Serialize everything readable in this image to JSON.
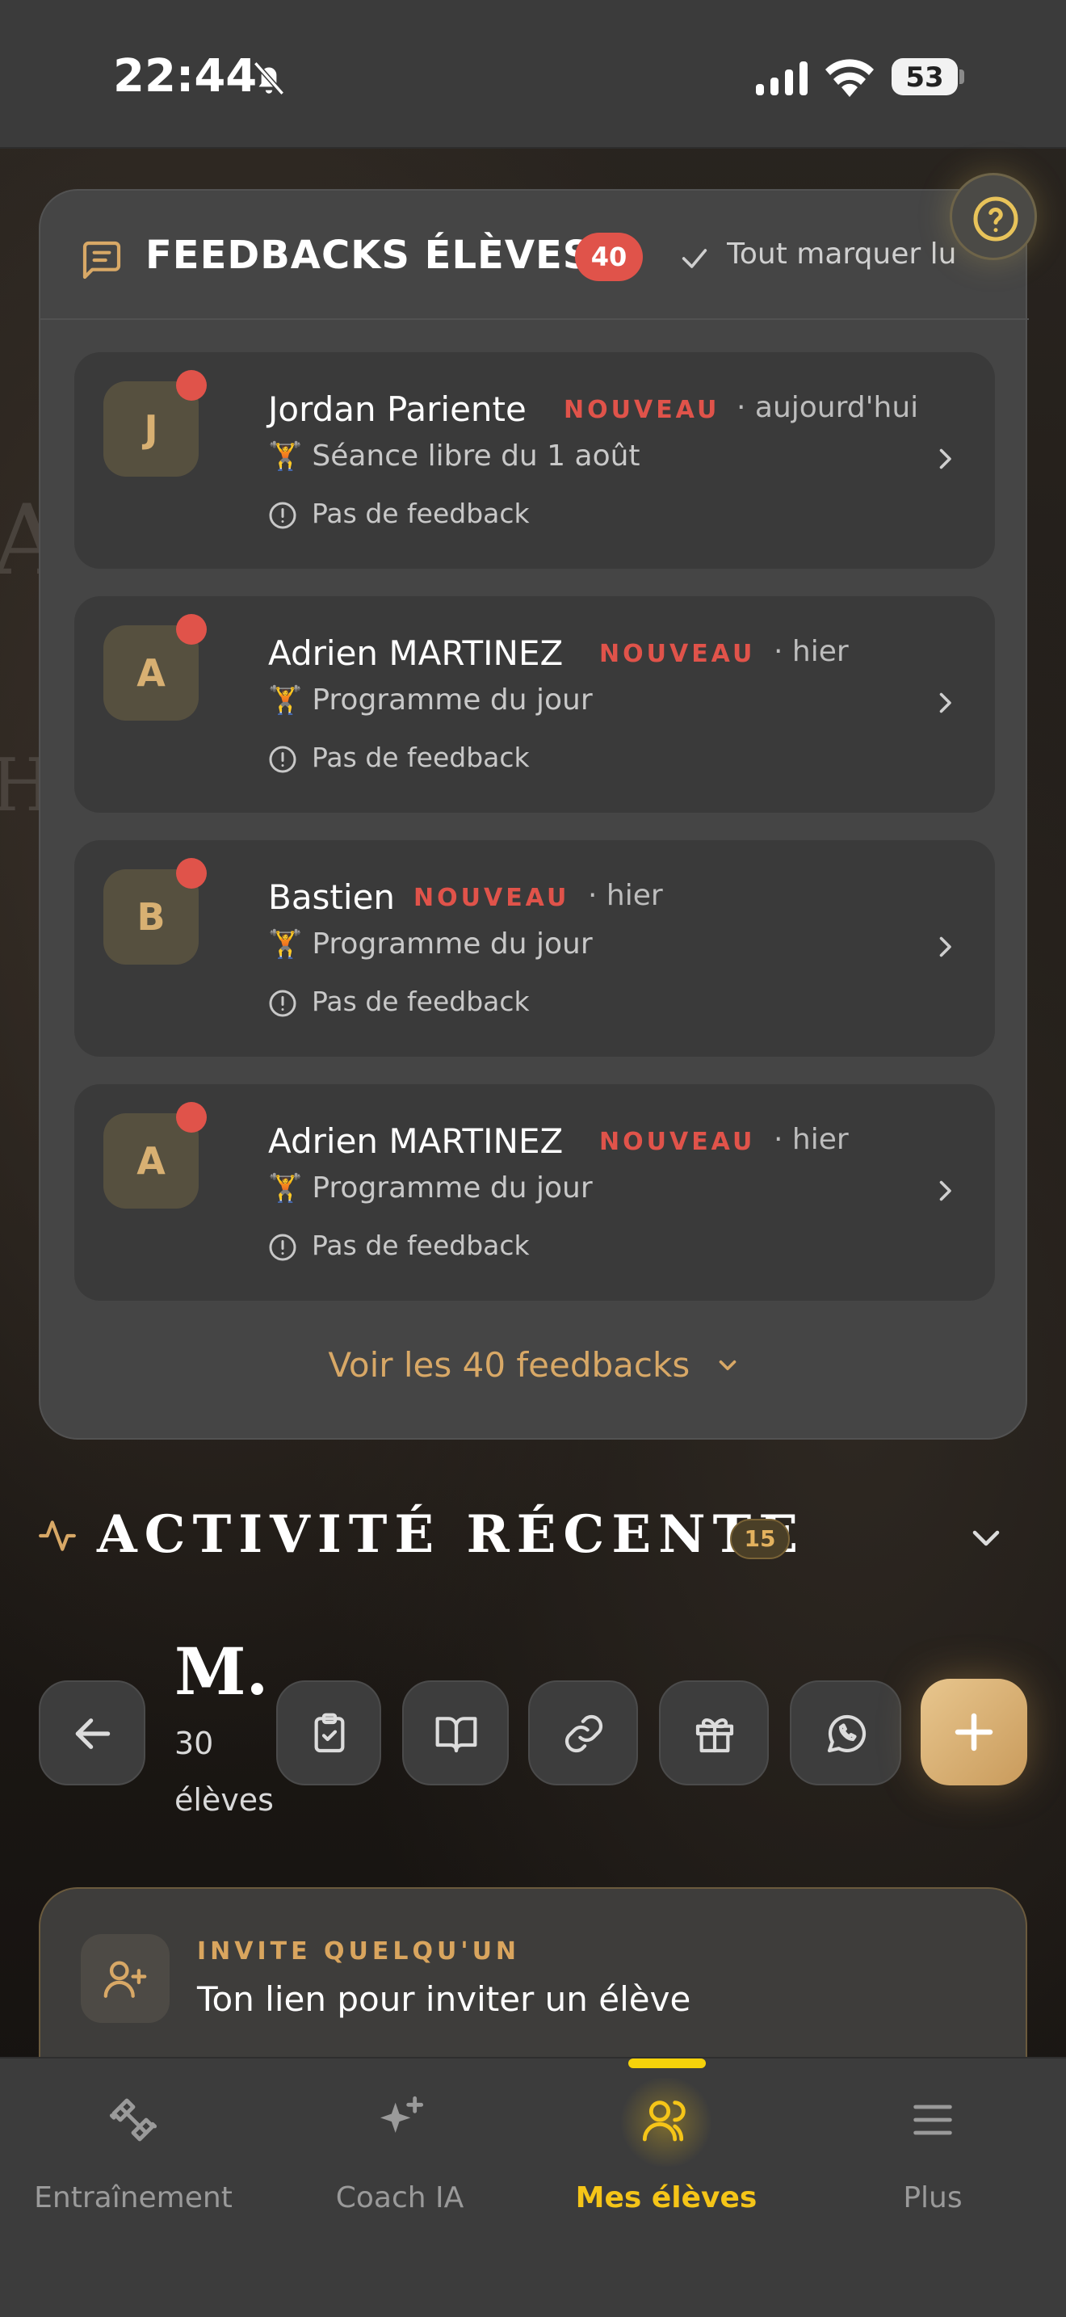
{
  "status_bar": {
    "time": "22:44",
    "battery": "53"
  },
  "feedbacks": {
    "title": "FEEDBACKS ÉLÈVES",
    "badge": "40",
    "mark_all": "Tout marquer lu",
    "items": [
      {
        "initial": "J",
        "name": "Jordan Pariente",
        "tag": "NOUVEAU",
        "when": "· aujourd'hui",
        "emoji": "🏋️",
        "session": "Séance libre du 1 août",
        "info": "Pas de feedback"
      },
      {
        "initial": "A",
        "name": "Adrien MARTINEZ",
        "tag": "NOUVEAU",
        "when": "· hier",
        "emoji": "🏋️",
        "session": "Programme du jour",
        "info": "Pas de feedback"
      },
      {
        "initial": "B",
        "name": "Bastien",
        "tag": "NOUVEAU",
        "when": "· hier",
        "emoji": "🏋️",
        "session": "Programme du jour",
        "info": "Pas de feedback"
      },
      {
        "initial": "A",
        "name": "Adrien MARTINEZ",
        "tag": "NOUVEAU",
        "when": "· hier",
        "emoji": "🏋️",
        "session": "Programme du jour",
        "info": "Pas de feedback"
      }
    ],
    "see_all": "Voir les 40 feedbacks"
  },
  "activity": {
    "title": "ACTIVITÉ RÉCENTE",
    "badge": "15"
  },
  "toolbar": {
    "brand": "M.",
    "count": "30",
    "count_label": "élèves",
    "icons": [
      "back-arrow-icon",
      "clipboard-check-icon",
      "book-open-icon",
      "link-icon",
      "gift-icon",
      "whatsapp-icon",
      "plus-icon"
    ]
  },
  "invite": {
    "kicker": "INVITE QUELQU'UN",
    "title": "Ton lien pour inviter un élève"
  },
  "nav": [
    {
      "label": "Entraînement",
      "icon": "dumbbell-icon",
      "active": false
    },
    {
      "label": "Coach IA",
      "icon": "sparkles-icon",
      "active": false
    },
    {
      "label": "Mes élèves",
      "icon": "users-icon",
      "active": true
    },
    {
      "label": "Plus",
      "icon": "menu-icon",
      "active": false
    }
  ],
  "colors": {
    "accent_gold": "#d8a866",
    "alert_red": "#e0534a",
    "nav_active": "#f5c518"
  }
}
